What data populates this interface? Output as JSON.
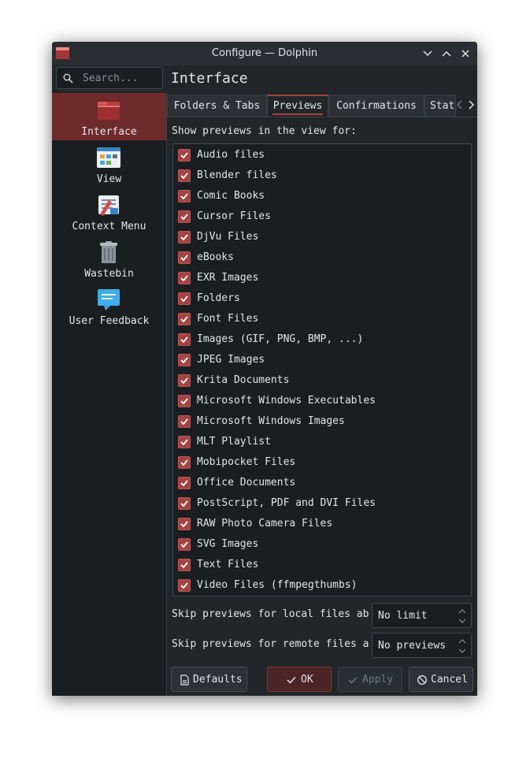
{
  "window": {
    "title": "Configure — Dolphin"
  },
  "search": {
    "placeholder": "Search..."
  },
  "page_header": "Interface",
  "sidebar": {
    "items": [
      {
        "label": "Interface",
        "icon": "folder-icon",
        "active": true
      },
      {
        "label": "View",
        "icon": "view-icon",
        "active": false
      },
      {
        "label": "Context Menu",
        "icon": "context-menu-icon",
        "active": false
      },
      {
        "label": "Wastebin",
        "icon": "wastebin-icon",
        "active": false
      },
      {
        "label": "User Feedback",
        "icon": "feedback-icon",
        "active": false
      }
    ]
  },
  "tabs": [
    {
      "label": "Folders & Tabs",
      "active": false
    },
    {
      "label": "Previews",
      "active": true
    },
    {
      "label": "Confirmations",
      "active": false
    },
    {
      "label": "Stat",
      "active": false
    }
  ],
  "previews": {
    "section_label": "Show previews in the view for:",
    "items": [
      {
        "label": "Audio files",
        "checked": true
      },
      {
        "label": "Blender files",
        "checked": true
      },
      {
        "label": "Comic Books",
        "checked": true
      },
      {
        "label": "Cursor Files",
        "checked": true
      },
      {
        "label": "DjVu Files",
        "checked": true
      },
      {
        "label": "eBooks",
        "checked": true
      },
      {
        "label": "EXR Images",
        "checked": true
      },
      {
        "label": "Folders",
        "checked": true
      },
      {
        "label": "Font Files",
        "checked": true
      },
      {
        "label": "Images (GIF, PNG, BMP, ...)",
        "checked": true
      },
      {
        "label": "JPEG Images",
        "checked": true
      },
      {
        "label": "Krita Documents",
        "checked": true
      },
      {
        "label": "Microsoft Windows Executables",
        "checked": true
      },
      {
        "label": "Microsoft Windows Images",
        "checked": true
      },
      {
        "label": "MLT Playlist",
        "checked": true
      },
      {
        "label": "Mobipocket Files",
        "checked": true
      },
      {
        "label": "Office Documents",
        "checked": true
      },
      {
        "label": "PostScript, PDF and DVI Files",
        "checked": true
      },
      {
        "label": "RAW Photo Camera Files",
        "checked": true
      },
      {
        "label": "SVG Images",
        "checked": true
      },
      {
        "label": "Text Files",
        "checked": true
      },
      {
        "label": "Video Files (ffmpegthumbs)",
        "checked": true
      }
    ]
  },
  "skip_local": {
    "label": "Skip previews for local files ab",
    "value": "No limit"
  },
  "skip_remote": {
    "label": "Skip previews for remote files a",
    "value": "No previews"
  },
  "buttons": {
    "defaults": "Defaults",
    "ok": "OK",
    "apply": "Apply",
    "cancel": "Cancel"
  },
  "colors": {
    "accent": "#a34343",
    "window_bg": "#232629",
    "sidebar_bg": "#1b1e20",
    "active_bg": "#6e2a2a"
  }
}
